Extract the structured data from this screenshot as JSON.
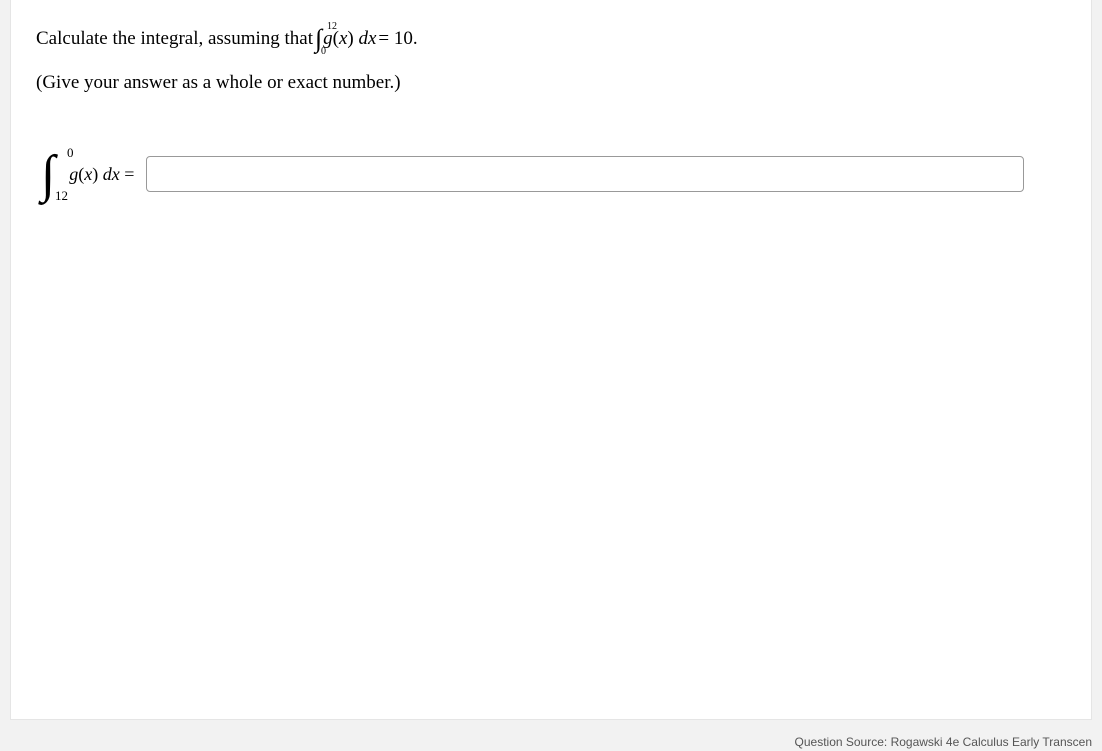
{
  "prompt": {
    "text_before": "Calculate the integral, assuming that ",
    "inline_integral": {
      "lower": "0",
      "upper": "12",
      "integrand_fn": "g",
      "integrand_var": "x",
      "differential": "dx"
    },
    "equals_value": " = 10.",
    "hint": "(Give your answer as a whole or exact number.)"
  },
  "answer_expr": {
    "lower": "12",
    "upper": "0",
    "integrand_fn": "g",
    "integrand_var": "x",
    "differential": "dx",
    "equals": " ="
  },
  "input": {
    "value": "",
    "placeholder": ""
  },
  "footer": {
    "source": "Question Source: Rogawski 4e Calculus Early Transcen"
  }
}
